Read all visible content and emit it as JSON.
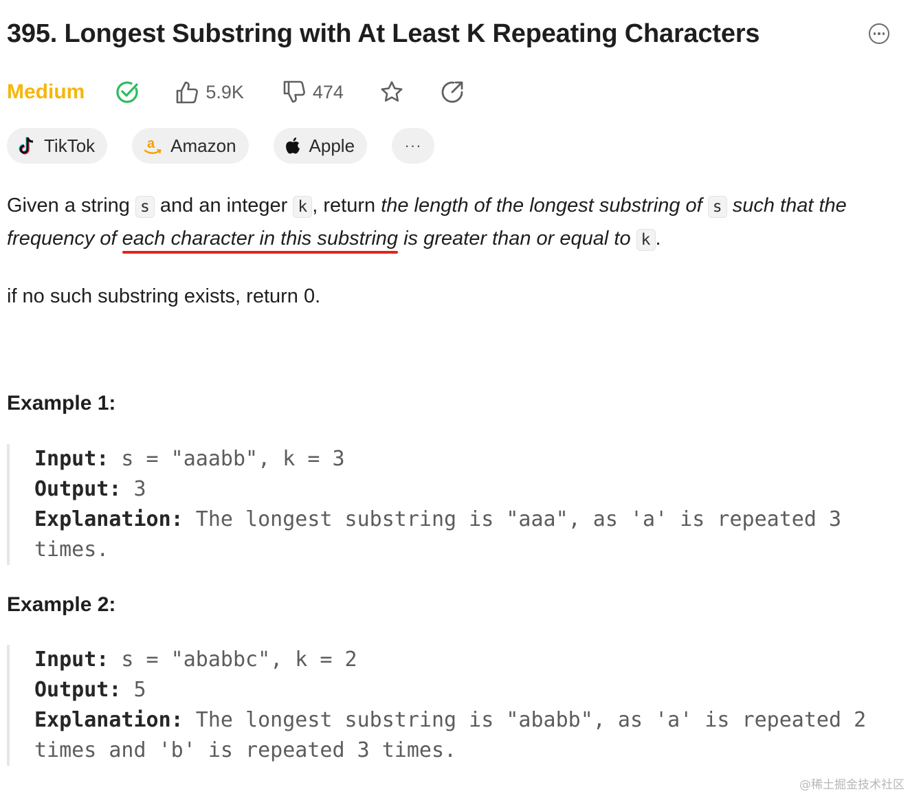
{
  "problem": {
    "title": "395. Longest Substring with At Least K Repeating Characters",
    "difficulty": "Medium",
    "likes": "5.9K",
    "dislikes": "474"
  },
  "colors": {
    "difficulty": "#f5b60b",
    "solved": "#2cbb5d",
    "underline": "#e3231b"
  },
  "icons": [
    "more-options-icon",
    "solved-check-icon",
    "thumbs-up-icon",
    "thumbs-down-icon",
    "star-icon",
    "share-icon",
    "tiktok-icon",
    "amazon-icon",
    "apple-icon"
  ],
  "tags": [
    {
      "name": "TikTok"
    },
    {
      "name": "Amazon"
    },
    {
      "name": "Apple"
    }
  ],
  "tags_more": "···",
  "description": {
    "t1": "Given a string ",
    "c1": "s",
    "t2": " and an integer ",
    "c2": "k",
    "t3": ", return ",
    "i1": "the length of the longest substring of ",
    "c3": "s",
    "i2": " such that the frequency of ",
    "i3": "each character in this substring",
    "i4": " is greater than or equal to ",
    "c4": "k",
    "t4": ".",
    "p2": "if no such substring exists, return 0."
  },
  "examples": [
    {
      "title": "Example 1:",
      "input_label": "Input:",
      "input": " s = \"aaabb\", k = 3",
      "output_label": "Output:",
      "output": " 3",
      "explanation_label": "Explanation:",
      "explanation": " The longest substring is \"aaa\", as 'a' is repeated 3 times."
    },
    {
      "title": "Example 2:",
      "input_label": "Input:",
      "input": " s = \"ababbc\", k = 2",
      "output_label": "Output:",
      "output": " 5",
      "explanation_label": "Explanation:",
      "explanation": " The longest substring is \"ababb\", as 'a' is repeated 2 times and 'b' is repeated 3 times."
    }
  ],
  "watermark": "@稀土掘金技术社区"
}
